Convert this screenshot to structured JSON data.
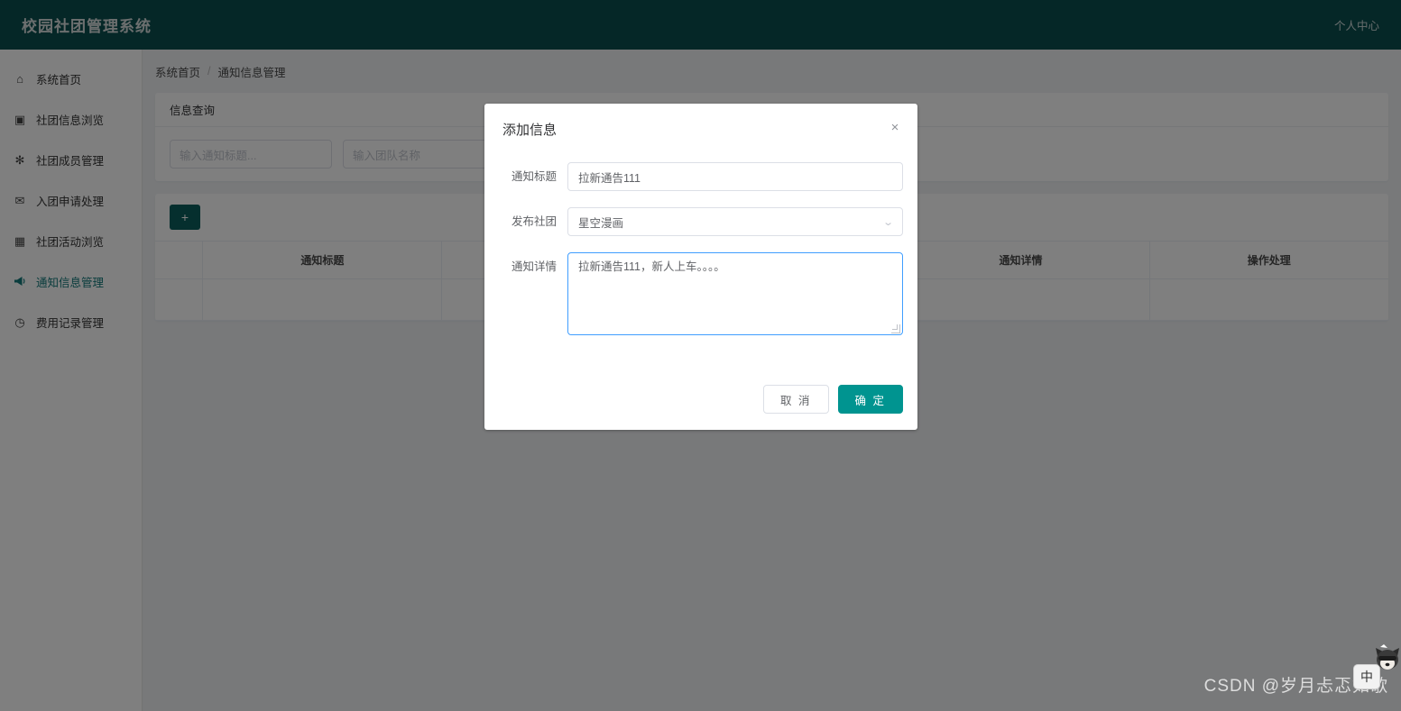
{
  "topbar": {
    "brand": "校园社团管理系统",
    "user_center": "个人中心"
  },
  "sidebar": {
    "items": [
      {
        "label": "系统首页",
        "icon": "home-icon",
        "glyph": "⌂",
        "active": false
      },
      {
        "label": "社团信息浏览",
        "icon": "building-icon",
        "glyph": "▣",
        "active": false
      },
      {
        "label": "社团成员管理",
        "icon": "users-icon",
        "glyph": "✻",
        "active": false
      },
      {
        "label": "入团申请处理",
        "icon": "envelope-icon",
        "glyph": "✉",
        "active": false
      },
      {
        "label": "社团活动浏览",
        "icon": "calendar-icon",
        "glyph": "▦",
        "active": false
      },
      {
        "label": "通知信息管理",
        "icon": "megaphone-icon",
        "glyph": "📢",
        "active": true
      },
      {
        "label": "费用记录管理",
        "icon": "clock-icon",
        "glyph": "◷",
        "active": false
      }
    ]
  },
  "breadcrumb": {
    "root": "系统首页",
    "separator": "/",
    "current": "通知信息管理"
  },
  "search_card": {
    "title": "信息查询",
    "title_input_placeholder": "输入通知标题...",
    "team_input_placeholder": "输入团队名称",
    "title_input_value": "",
    "team_input_value": ""
  },
  "table_card": {
    "add_button_label": "+",
    "columns": [
      "",
      "通知标题",
      "",
      "",
      "通知详情",
      "操作处理"
    ],
    "rows": []
  },
  "dialog": {
    "title": "添加信息",
    "close_label": "×",
    "fields": {
      "notice_title_label": "通知标题",
      "notice_title_value": "拉新通告111",
      "club_label": "发布社团",
      "club_value": "星空漫画",
      "club_caret": "⌄",
      "detail_label": "通知详情",
      "detail_value": "拉新通告111，新人上车。。。。"
    },
    "cancel_label": "取 消",
    "confirm_label": "确 定"
  },
  "overlays": {
    "watermark": "CSDN @岁月忐忑如歌",
    "ime_mode": "中"
  },
  "colors": {
    "header_bg": "#0b4f4f",
    "accent": "#009490",
    "add_button": "#0b5e5c",
    "focus_border": "#409eff",
    "active_nav": "#13797a"
  }
}
